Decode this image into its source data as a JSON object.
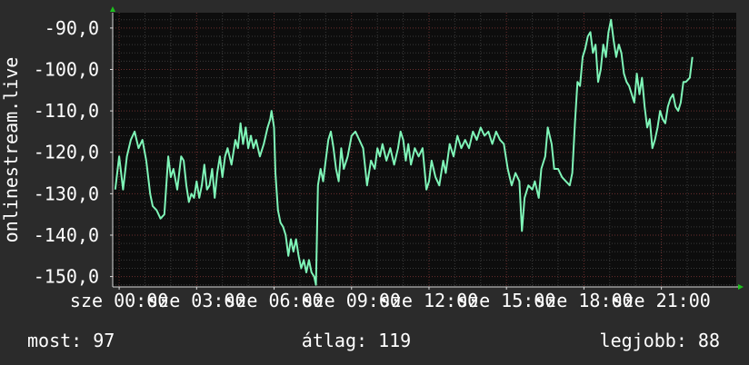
{
  "chart_data": {
    "type": "line",
    "ylabel": "onlinestream.live",
    "ylim": [
      -152.5,
      -86.3
    ],
    "y_ticks": [
      -150,
      -140,
      -130,
      -120,
      -110,
      -100,
      -90
    ],
    "y_tick_labels": [
      "-150,0",
      "-140,0",
      "-130,0",
      "-120,0",
      "-110,0",
      "-100,0",
      "-90,0"
    ],
    "xlim": [
      -0.25,
      23.9
    ],
    "x_ticks": [
      0,
      3,
      6,
      9,
      12,
      15,
      18,
      21
    ],
    "x_tick_labels": [
      "sze 00:00",
      "sze 03:00",
      "sze 06:00",
      "sze 09:00",
      "sze 12:00",
      "sze 15:00",
      "sze 18:00",
      "sze 21:00"
    ],
    "x_unit": "hour of day",
    "grid": true,
    "line_color": "#7ff5b8",
    "series": [
      {
        "values": [
          [
            -0.15,
            -129
          ],
          [
            0.0,
            -121
          ],
          [
            0.15,
            -129
          ],
          [
            0.3,
            -121
          ],
          [
            0.45,
            -117
          ],
          [
            0.6,
            -115
          ],
          [
            0.75,
            -119
          ],
          [
            0.9,
            -117
          ],
          [
            1.05,
            -122
          ],
          [
            1.2,
            -130
          ],
          [
            1.3,
            -133
          ],
          [
            1.45,
            -134
          ],
          [
            1.6,
            -136
          ],
          [
            1.75,
            -135
          ],
          [
            1.9,
            -121
          ],
          [
            2.0,
            -126
          ],
          [
            2.1,
            -124
          ],
          [
            2.25,
            -129
          ],
          [
            2.4,
            -121
          ],
          [
            2.5,
            -122
          ],
          [
            2.6,
            -128
          ],
          [
            2.7,
            -132
          ],
          [
            2.8,
            -130
          ],
          [
            2.9,
            -131
          ],
          [
            3.0,
            -127
          ],
          [
            3.1,
            -131
          ],
          [
            3.2,
            -128
          ],
          [
            3.3,
            -123
          ],
          [
            3.4,
            -129
          ],
          [
            3.5,
            -128
          ],
          [
            3.6,
            -124
          ],
          [
            3.7,
            -131
          ],
          [
            3.8,
            -125
          ],
          [
            3.9,
            -121
          ],
          [
            4.0,
            -126
          ],
          [
            4.1,
            -121
          ],
          [
            4.2,
            -119
          ],
          [
            4.35,
            -123
          ],
          [
            4.5,
            -117
          ],
          [
            4.6,
            -119
          ],
          [
            4.7,
            -113
          ],
          [
            4.8,
            -118
          ],
          [
            4.9,
            -114
          ],
          [
            5.0,
            -119
          ],
          [
            5.1,
            -116
          ],
          [
            5.2,
            -119
          ],
          [
            5.3,
            -117
          ],
          [
            5.45,
            -121
          ],
          [
            5.6,
            -118
          ],
          [
            5.75,
            -114
          ],
          [
            5.85,
            -112
          ],
          [
            5.9,
            -110
          ],
          [
            6.0,
            -114
          ],
          [
            6.05,
            -125
          ],
          [
            6.15,
            -134
          ],
          [
            6.25,
            -137
          ],
          [
            6.35,
            -138
          ],
          [
            6.45,
            -140
          ],
          [
            6.55,
            -145
          ],
          [
            6.65,
            -141
          ],
          [
            6.75,
            -144
          ],
          [
            6.85,
            -141
          ],
          [
            6.95,
            -145
          ],
          [
            7.05,
            -148
          ],
          [
            7.15,
            -146
          ],
          [
            7.25,
            -149
          ],
          [
            7.35,
            -146
          ],
          [
            7.45,
            -149
          ],
          [
            7.55,
            -150
          ],
          [
            7.62,
            -152
          ],
          [
            7.7,
            -128
          ],
          [
            7.8,
            -124
          ],
          [
            7.9,
            -127
          ],
          [
            8.0,
            -122
          ],
          [
            8.1,
            -117
          ],
          [
            8.2,
            -115
          ],
          [
            8.3,
            -119
          ],
          [
            8.4,
            -124
          ],
          [
            8.5,
            -127
          ],
          [
            8.6,
            -119
          ],
          [
            8.7,
            -124
          ],
          [
            8.85,
            -121
          ],
          [
            9.0,
            -116
          ],
          [
            9.15,
            -115
          ],
          [
            9.3,
            -117
          ],
          [
            9.45,
            -119
          ],
          [
            9.6,
            -128
          ],
          [
            9.75,
            -122
          ],
          [
            9.9,
            -124
          ],
          [
            10.0,
            -119
          ],
          [
            10.1,
            -121
          ],
          [
            10.2,
            -118
          ],
          [
            10.35,
            -122
          ],
          [
            10.5,
            -119
          ],
          [
            10.65,
            -123
          ],
          [
            10.8,
            -119
          ],
          [
            10.9,
            -115
          ],
          [
            11.0,
            -117
          ],
          [
            11.1,
            -122
          ],
          [
            11.2,
            -118
          ],
          [
            11.3,
            -123
          ],
          [
            11.45,
            -119
          ],
          [
            11.6,
            -121
          ],
          [
            11.75,
            -119
          ],
          [
            11.9,
            -129
          ],
          [
            12.0,
            -127
          ],
          [
            12.1,
            -122
          ],
          [
            12.25,
            -126
          ],
          [
            12.4,
            -128
          ],
          [
            12.55,
            -122
          ],
          [
            12.65,
            -125
          ],
          [
            12.8,
            -118
          ],
          [
            12.95,
            -121
          ],
          [
            13.1,
            -116
          ],
          [
            13.25,
            -119
          ],
          [
            13.4,
            -117
          ],
          [
            13.55,
            -119
          ],
          [
            13.7,
            -115
          ],
          [
            13.85,
            -117
          ],
          [
            14.0,
            -114
          ],
          [
            14.15,
            -116
          ],
          [
            14.3,
            -115
          ],
          [
            14.45,
            -118
          ],
          [
            14.6,
            -115
          ],
          [
            14.75,
            -117
          ],
          [
            14.9,
            -118
          ],
          [
            15.05,
            -124
          ],
          [
            15.2,
            -128
          ],
          [
            15.35,
            -125
          ],
          [
            15.5,
            -127
          ],
          [
            15.6,
            -139
          ],
          [
            15.7,
            -131
          ],
          [
            15.85,
            -128
          ],
          [
            16.0,
            -129
          ],
          [
            16.1,
            -127
          ],
          [
            16.25,
            -131
          ],
          [
            16.35,
            -124
          ],
          [
            16.5,
            -121
          ],
          [
            16.6,
            -114
          ],
          [
            16.75,
            -118
          ],
          [
            16.85,
            -124
          ],
          [
            17.0,
            -124
          ],
          [
            17.15,
            -126
          ],
          [
            17.3,
            -127
          ],
          [
            17.45,
            -128
          ],
          [
            17.55,
            -125
          ],
          [
            17.65,
            -113
          ],
          [
            17.75,
            -103
          ],
          [
            17.85,
            -104
          ],
          [
            17.95,
            -97
          ],
          [
            18.05,
            -95
          ],
          [
            18.15,
            -92
          ],
          [
            18.25,
            -91
          ],
          [
            18.35,
            -96
          ],
          [
            18.45,
            -94
          ],
          [
            18.55,
            -103
          ],
          [
            18.65,
            -100
          ],
          [
            18.75,
            -94
          ],
          [
            18.85,
            -97
          ],
          [
            18.95,
            -91
          ],
          [
            19.05,
            -88
          ],
          [
            19.15,
            -93
          ],
          [
            19.25,
            -97
          ],
          [
            19.35,
            -94
          ],
          [
            19.45,
            -96
          ],
          [
            19.55,
            -101
          ],
          [
            19.65,
            -103
          ],
          [
            19.75,
            -104
          ],
          [
            19.85,
            -106
          ],
          [
            19.95,
            -108
          ],
          [
            20.05,
            -101
          ],
          [
            20.15,
            -106
          ],
          [
            20.25,
            -102
          ],
          [
            20.35,
            -109
          ],
          [
            20.45,
            -114
          ],
          [
            20.55,
            -112
          ],
          [
            20.65,
            -119
          ],
          [
            20.75,
            -117
          ],
          [
            20.85,
            -114
          ],
          [
            20.95,
            -110
          ],
          [
            21.05,
            -112
          ],
          [
            21.15,
            -113
          ],
          [
            21.25,
            -109
          ],
          [
            21.35,
            -107
          ],
          [
            21.45,
            -106
          ],
          [
            21.55,
            -109
          ],
          [
            21.65,
            -110
          ],
          [
            21.75,
            -108
          ],
          [
            21.85,
            -103
          ],
          [
            21.95,
            -103
          ],
          [
            22.1,
            -102
          ],
          [
            22.2,
            -97
          ]
        ]
      }
    ],
    "stats": [
      {
        "label": "most:",
        "value": "97"
      },
      {
        "label": "átlag:",
        "value": "119"
      },
      {
        "label": "legjobb:",
        "value": "88"
      }
    ]
  }
}
